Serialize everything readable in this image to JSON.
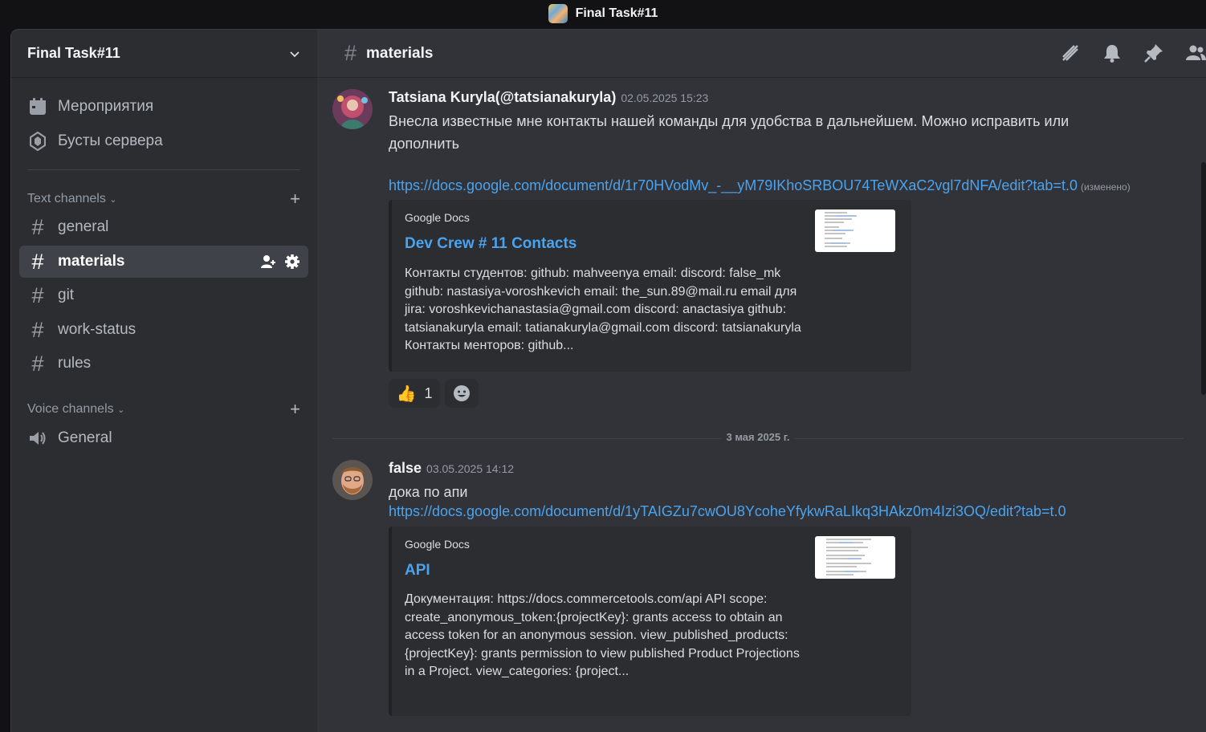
{
  "window": {
    "title": "Final Task#11"
  },
  "sidebar": {
    "server_name": "Final Task#11",
    "top_items": [
      {
        "label": "Мероприятия",
        "icon": "calendar-icon"
      },
      {
        "label": "Бусты сервера",
        "icon": "boost-icon"
      }
    ],
    "text_category": "Text channels",
    "text_channels": [
      "general",
      "materials",
      "git",
      "work-status",
      "rules"
    ],
    "active_channel": "materials",
    "voice_category": "Voice channels",
    "voice_channels": [
      "General"
    ]
  },
  "channel_header": {
    "name": "materials",
    "icons": [
      "threads-icon",
      "bell-icon",
      "pin-icon",
      "members-icon"
    ]
  },
  "messages": [
    {
      "author": "Tatsiana Kuryla(@tatsianakuryla)",
      "timestamp": "02.05.2025 15:23",
      "text_line1": "Внесла известные мне контакты нашей команды для удобства в дальнейшем. Можно исправить или",
      "text_line2": "дополнить",
      "link": "https://docs.google.com/document/d/1r70HVodMv_-__yM79IKhoSRBOU74TeWXaC2vgl7dNFA/edit?tab=t.0",
      "edited": "(изменено)",
      "embed": {
        "provider": "Google Docs",
        "title": "Dev Crew # 11 Contacts",
        "description": "Контакты студентов: github: mahveenya email: discord: false_mk github: nastasiya-voroshkevich email: the_sun.89@mail.ru email для jira: voroshkevichanastasia@gmail.com discord: anactasiya github: tatsianakuryla email: tatianakuryla@gmail.com discord: tatsianakuryla Контакты менторов: github..."
      },
      "reactions": [
        {
          "emoji": "👍",
          "count": "1"
        }
      ]
    },
    {
      "author": "false",
      "timestamp": "03.05.2025 14:12",
      "text_line1": "дока по апи",
      "link": "https://docs.google.com/document/d/1yTAIGZu7cwOU8YcoheYfykwRaLIkq3HAkz0m4Izi3OQ/edit?tab=t.0",
      "embed": {
        "provider": "Google Docs",
        "title": "API",
        "description": "Документация: https://docs.commercetools.com/api API scope: create_anonymous_token:{projectKey}: grants access to obtain an access token for an anonymous session. view_published_products:{projectKey}: grants permission to view published Product Projections in a Project. view_categories: {project..."
      }
    }
  ],
  "date_separator": "3 мая 2025 г."
}
